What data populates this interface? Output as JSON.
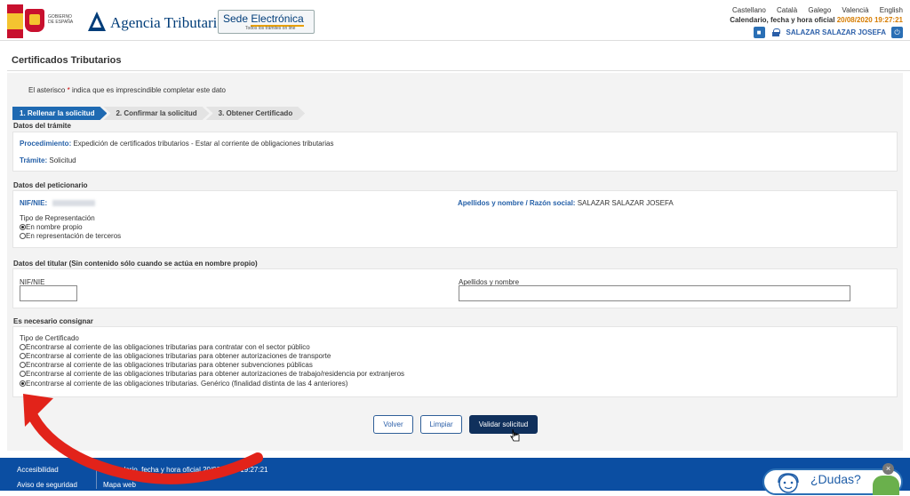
{
  "header": {
    "gov_logo_text": "GOBIERNO\nDE ESPAÑA",
    "agency_name": "Agencia Tributaria",
    "sede_title_1": "Sede ",
    "sede_title_2": "Electrónica",
    "sede_subtitle": "Todos los trámites on line",
    "languages": [
      "Castellano",
      "Català",
      "Galego",
      "Valencià",
      "English"
    ],
    "calendar_label": "Calendario, fecha y hora oficial",
    "calendar_datetime": "20/08/2020 19:27:21",
    "user_name": "SALAZAR SALAZAR JOSEFA"
  },
  "page": {
    "title": "Certificados Tributarios",
    "mandatory_note_pre": "El asterisco",
    "mandatory_note_star": "*",
    "mandatory_note_post": "indica que es imprescindible completar este dato"
  },
  "steps": [
    {
      "label": "1. Rellenar la solicitud",
      "active": true
    },
    {
      "label": "2. Confirmar la solicitud",
      "active": false
    },
    {
      "label": "3. Obtener Certificado",
      "active": false
    }
  ],
  "tramite": {
    "section_title": "Datos del trámite",
    "procedimiento_label": "Procedimiento:",
    "procedimiento_value": "Expedición de certificados tributarios - Estar al corriente de obligaciones tributarias",
    "tramite_label": "Trámite:",
    "tramite_value": "Solicitud"
  },
  "peticionario": {
    "section_title": "Datos del peticionario",
    "nif_label": "NIF/NIE:",
    "apellidos_label": "Apellidos y nombre / Razón social:",
    "apellidos_value": "SALAZAR SALAZAR JOSEFA",
    "representacion_label": "Tipo de Representación",
    "options": [
      {
        "label": "En nombre propio",
        "selected": true
      },
      {
        "label": "En representación de terceros",
        "selected": false
      }
    ]
  },
  "titular": {
    "section_title": "Datos del titular (Sin contenido sólo cuando se actúa en nombre propio)",
    "nif_label": "NIF/NIE",
    "nif_value": "",
    "apellidos_label": "Apellidos y nombre",
    "apellidos_value": ""
  },
  "consignar": {
    "section_title": "Es necesario consignar",
    "tipo_label": "Tipo de Certificado",
    "options": [
      {
        "label": "Encontrarse al corriente de las obligaciones tributarias para contratar con el sector público",
        "selected": false
      },
      {
        "label": "Encontrarse al corriente de las obligaciones tributarias para obtener autorizaciones de transporte",
        "selected": false
      },
      {
        "label": "Encontrarse al corriente de las obligaciones tributarias para obtener subvenciones públicas",
        "selected": false
      },
      {
        "label": "Encontrarse al corriente de las obligaciones tributarias para obtener autorizaciones de trabajo/residencia por extranjeros",
        "selected": false
      },
      {
        "label": "Encontrarse al corriente de las obligaciones tributarias. Genérico (finalidad distinta de las 4 anteriores)",
        "selected": true
      }
    ]
  },
  "buttons": {
    "volver": "Volver",
    "limpiar": "Limpiar",
    "validar": "Validar solicitud"
  },
  "footer": {
    "links_col1": [
      "Accesibilidad",
      "Aviso de seguridad"
    ],
    "calendar_text": "Calendario, fecha y hora oficial 20/08/2020 19:27:21",
    "mapa_web": "Mapa web",
    "help_label": "¿Dudas?"
  },
  "colors": {
    "brand_blue": "#003d79",
    "step_active": "#1f6ab2",
    "footer_blue": "#0b4ea2",
    "annotation_arrow": "#e2231a"
  }
}
